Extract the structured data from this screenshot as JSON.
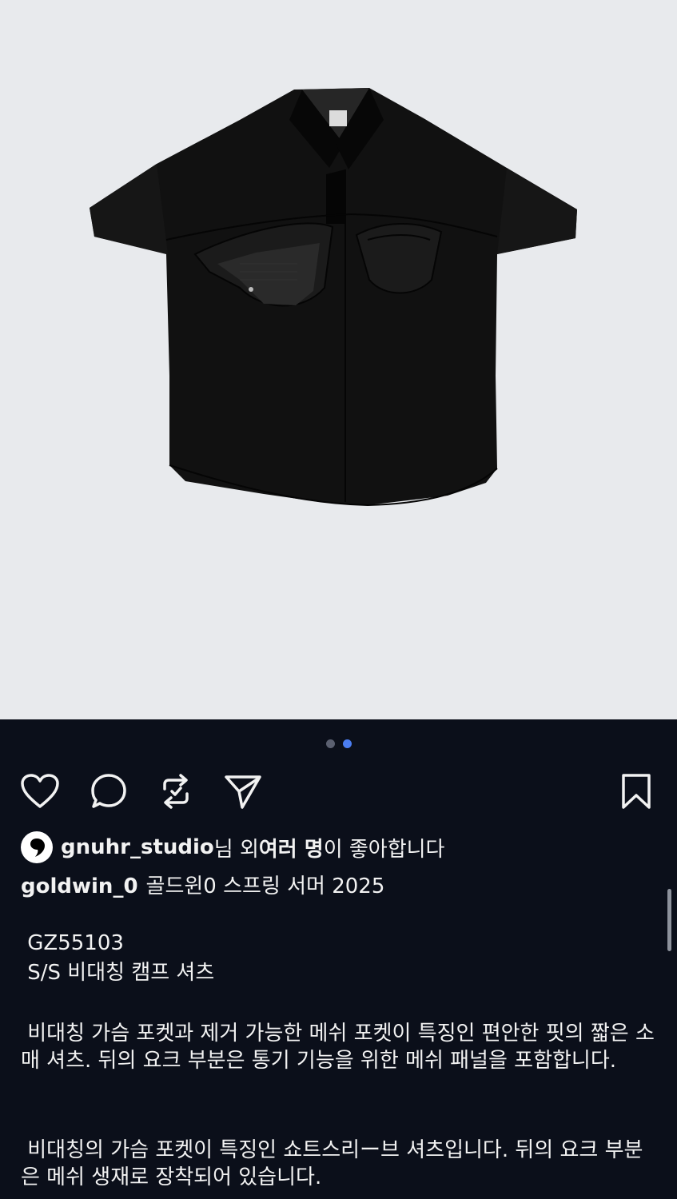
{
  "post": {
    "image_alt": "black short-sleeve camp shirt with asymmetric chest pockets",
    "carousel": {
      "total": 2,
      "active_index": 1
    },
    "actions": [
      "heart-icon",
      "comment-icon",
      "repost-icon",
      "send-icon",
      "bookmark-icon"
    ],
    "likes": {
      "user": "gnuhr_studio",
      "text_middle": "님 외 ",
      "text_strong": "여러 명",
      "text_end": "이 좋아합니다"
    },
    "author": "goldwin_0",
    "caption_title": "골드윈0 스프링 서머 2025",
    "product_code": " GZ55103",
    "product_name": " S/S 비대칭 캠프 셔츠",
    "paragraph1": " 비대칭 가슴 포켓과 제거 가능한 메쉬 포켓이 특징인 편안한 핏의 짧은 소매 셔츠. 뒤의 요크 부분은 통기 기능을 위한 메쉬 패널을 포함합니다.",
    "paragraph2": " 비대칭의 가슴 포켓이 특징인 쇼트스리ー브 셔츠입니다. 뒤의 요크 부분은 메쉬 생재로 장착되어 있습니다."
  },
  "colors": {
    "background": "#0b0f1a",
    "photo_background": "#e8eaed",
    "dot_active": "#4b7df0",
    "dot_inactive": "#5b6070"
  }
}
